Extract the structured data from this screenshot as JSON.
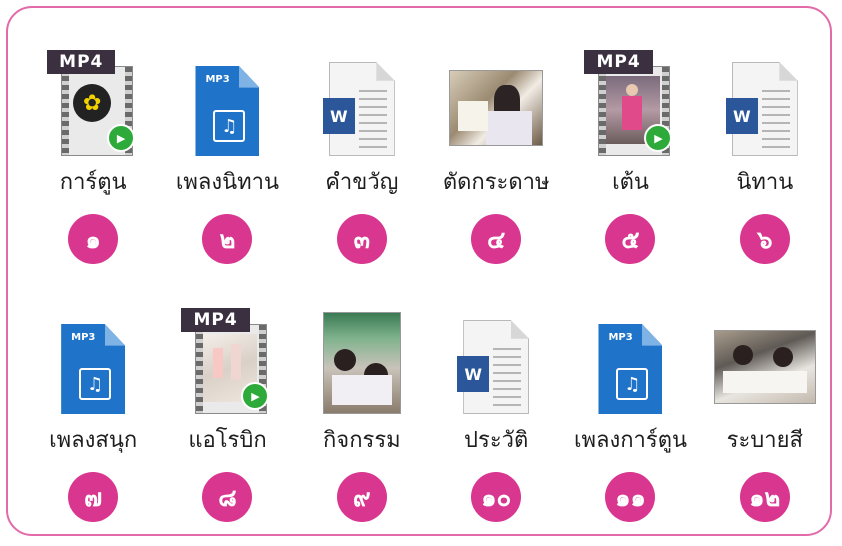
{
  "row1": [
    {
      "label": "การ์ตูน",
      "number": "๑",
      "type": "mp4",
      "icon": "mp4-file-icon",
      "tag": "MP4"
    },
    {
      "label": "เพลงนิทาน",
      "number": "๒",
      "type": "mp3",
      "icon": "mp3-file-icon",
      "tag": "MP3"
    },
    {
      "label": "คำขวัญ",
      "number": "๓",
      "type": "doc",
      "icon": "word-document-icon",
      "tag": "W"
    },
    {
      "label": "ตัดกระดาษ",
      "number": "๔",
      "type": "photo",
      "icon": "photo-thumbnail-icon"
    },
    {
      "label": "เต้น",
      "number": "๕",
      "type": "mp4",
      "icon": "mp4-file-icon",
      "tag": "MP4"
    },
    {
      "label": "นิทาน",
      "number": "๖",
      "type": "doc",
      "icon": "word-document-icon",
      "tag": "W"
    }
  ],
  "row2": [
    {
      "label": "เพลงสนุก",
      "number": "๗",
      "type": "mp3",
      "icon": "mp3-file-icon",
      "tag": "MP3"
    },
    {
      "label": "แอโรบิก",
      "number": "๘",
      "type": "mp4",
      "icon": "mp4-file-icon",
      "tag": "MP4"
    },
    {
      "label": "กิจกรรม",
      "number": "๙",
      "type": "photo",
      "icon": "photo-thumbnail-icon"
    },
    {
      "label": "ประวัติ",
      "number": "๑๐",
      "type": "doc",
      "icon": "word-document-icon",
      "tag": "W"
    },
    {
      "label": "เพลงการ์ตูน",
      "number": "๑๑",
      "type": "mp3",
      "icon": "mp3-file-icon",
      "tag": "MP3"
    },
    {
      "label": "ระบายสี",
      "number": "๑๒",
      "type": "photo",
      "icon": "photo-thumbnail-icon"
    }
  ],
  "colors": {
    "frame_border": "#e36aa9",
    "badge": "#d9368f",
    "word_blue": "#2b579a",
    "mp3_blue": "#1f73c8",
    "play_green": "#2eaa3a"
  }
}
